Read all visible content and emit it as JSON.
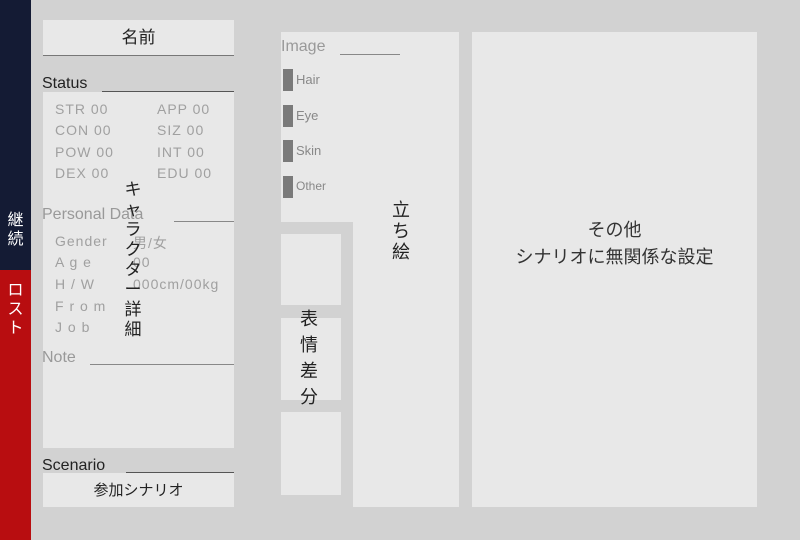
{
  "sidebar": {
    "top_tab": [
      "継",
      "続"
    ],
    "bottom_tab": [
      "ロ",
      "ス",
      "ト"
    ],
    "colors": {
      "top": "#141b34",
      "bottom": "#b80d10"
    }
  },
  "name_field": "名前",
  "status": {
    "title": "Status",
    "rows": [
      {
        "left": "STR 00",
        "right": "APP 00"
      },
      {
        "left": "CON 00",
        "right": "SIZ 00"
      },
      {
        "left": "POW 00",
        "right": "INT 00"
      },
      {
        "left": "DEX 00",
        "right": "EDU 00"
      }
    ]
  },
  "personal": {
    "title": "Personal Data",
    "rows": [
      {
        "label": "Gender",
        "value": "男/女"
      },
      {
        "label": "A g e",
        "value": "00"
      },
      {
        "label": "H / W",
        "value": "000cm/00kg"
      },
      {
        "label": "F r o m",
        "value": ""
      },
      {
        "label": "J o b",
        "value": ""
      }
    ]
  },
  "character_detail_vertical": [
    "キ",
    "ャ",
    "ラ",
    "ク",
    "タ",
    "ー",
    "詳",
    "細"
  ],
  "note": {
    "title": "Note"
  },
  "scenario": {
    "title": "Scenario",
    "value": "参加シナリオ"
  },
  "image": {
    "title": "Image",
    "swatches": [
      "Hair",
      "Eye",
      "Skin",
      "Other"
    ]
  },
  "standing_vertical": [
    "立",
    "ち",
    "絵"
  ],
  "expression_vertical": [
    "表",
    "情",
    "差",
    "分"
  ],
  "other": {
    "line1": "その他",
    "line2": "シナリオに無関係な設定"
  }
}
